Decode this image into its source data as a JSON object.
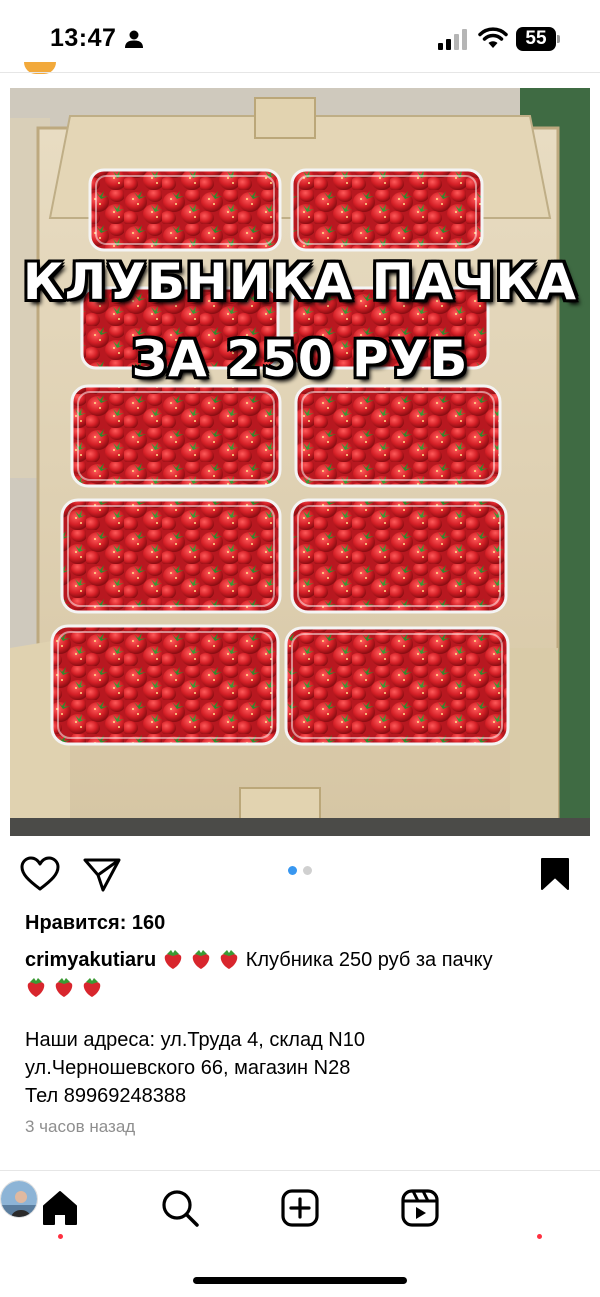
{
  "status_bar": {
    "time": "13:47",
    "battery_level": "55",
    "icons": [
      "person-icon",
      "signal-icon",
      "wifi-icon",
      "battery-icon"
    ]
  },
  "post": {
    "image_overlay_line1": "КЛУБНИКА ПАЧКА",
    "image_overlay_line2": "ЗА 250 РУБ",
    "carousel_dots": {
      "total": 2,
      "active_index": 0
    },
    "likes": "Нравится: 160",
    "username": "crimyakutiaru",
    "caption_text": "Клубника 250 руб за пачку",
    "caption_emoji": "strawberry",
    "address_lines": [
      "Наши адреса: ул.Труда 4, склад N10",
      "ул.Черношевского 66, магазин N28",
      "Тел 89969248388"
    ],
    "timestamp": "3 часов назад"
  },
  "actions": {
    "icons": [
      "heart-icon",
      "share-icon",
      "bookmark-icon"
    ]
  },
  "bottom_nav": {
    "items": [
      "home-icon",
      "search-icon",
      "create-icon",
      "reels-icon",
      "profile-avatar"
    ]
  },
  "colors": {
    "accent": "#3897f0",
    "notification": "#ff3040",
    "secondary_text": "#8e8e8e"
  }
}
